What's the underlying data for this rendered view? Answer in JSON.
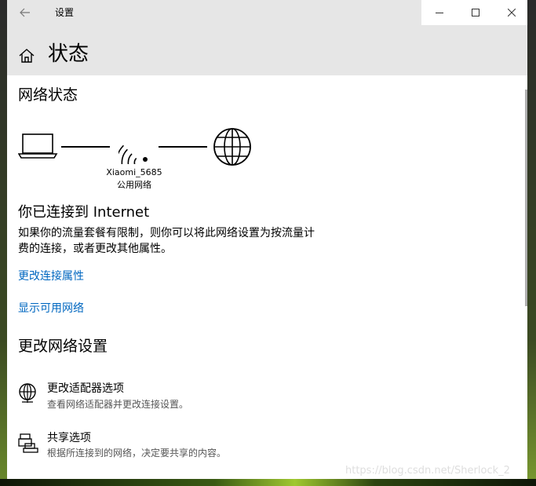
{
  "window": {
    "title": "设置"
  },
  "header": {
    "page_title": "状态"
  },
  "network_status": {
    "heading": "网络状态",
    "network_name": "Xiaomi_5685",
    "network_type": "公用网络"
  },
  "connection": {
    "heading": "你已连接到 Internet",
    "description_line1": "如果你的流量套餐有限制，则你可以将此网络设置为按流量计",
    "description_line2": "费的连接，或者更改其他属性。"
  },
  "links": {
    "change_properties": "更改连接属性",
    "show_networks": "显示可用网络"
  },
  "change_settings": {
    "heading": "更改网络设置",
    "items": [
      {
        "title": "更改适配器选项",
        "description": "查看网络适配器并更改连接设置。"
      },
      {
        "title": "共享选项",
        "description": "根据所连接到的网络，决定要共享的内容。"
      }
    ]
  },
  "watermark": "https://blog.csdn.net/Sherlock_2"
}
